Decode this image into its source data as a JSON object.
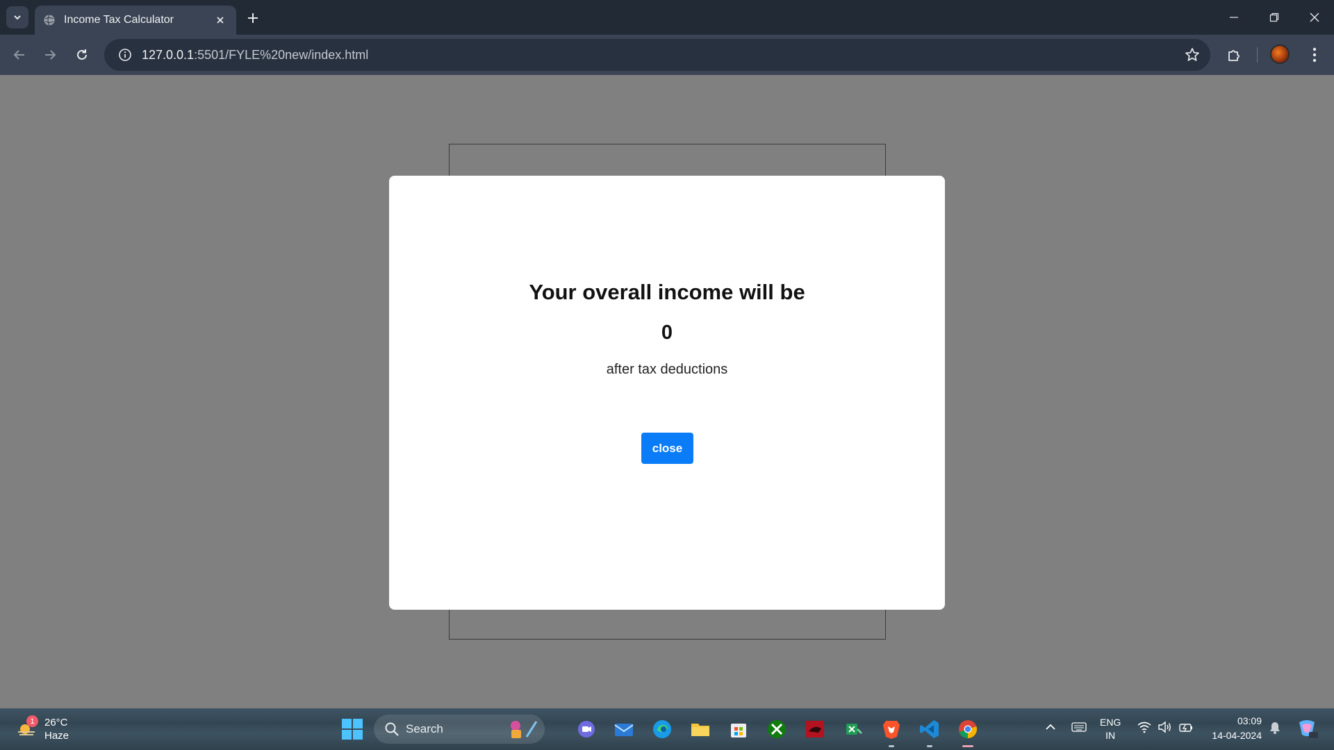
{
  "browser": {
    "tab_title": "Income Tax Calculator",
    "url_host": "127.0.0.1",
    "url_rest": ":5501/FYLE%20new/index.html"
  },
  "modal": {
    "heading": "Your overall income will be",
    "amount": "0",
    "note": "after tax deductions",
    "close_label": "close"
  },
  "taskbar": {
    "weather_badge": "1",
    "temperature": "26°C",
    "condition": "Haze",
    "search_label": "Search",
    "lang_top": "ENG",
    "lang_bottom": "IN",
    "time": "03:09",
    "date": "14-04-2024"
  },
  "colors": {
    "overlay": "#808080",
    "accent_button": "#0a7cf8",
    "chrome_dark": "#222a36",
    "chrome_toolbar": "#3a4454"
  },
  "icons": [
    "tab-list-icon",
    "globe-icon",
    "close-tab-icon",
    "new-tab-icon",
    "minimize-icon",
    "restore-icon",
    "close-window-icon",
    "back-icon",
    "forward-icon",
    "reload-icon",
    "site-info-icon",
    "bookmark-star-icon",
    "extensions-icon",
    "profile-avatar",
    "menu-icon",
    "weather-icon",
    "windows-start-icon",
    "search-icon"
  ]
}
